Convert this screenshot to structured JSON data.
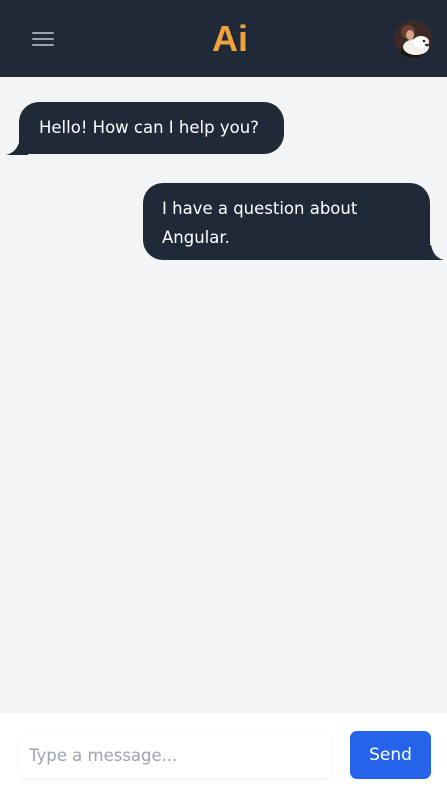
{
  "header": {
    "logo_text": "Ai",
    "menu_icon": "hamburger-menu-icon",
    "avatar_icon": "user-avatar",
    "background": "#1f2937",
    "logo_color": "#f0a23b"
  },
  "messages": [
    {
      "sender": "bot",
      "text": "Hello! How can I help you?"
    },
    {
      "sender": "user",
      "text": "I have a question about Angular."
    }
  ],
  "composer": {
    "placeholder": "Type a message...",
    "value": "",
    "send_label": "Send",
    "send_color": "#2563eb"
  }
}
